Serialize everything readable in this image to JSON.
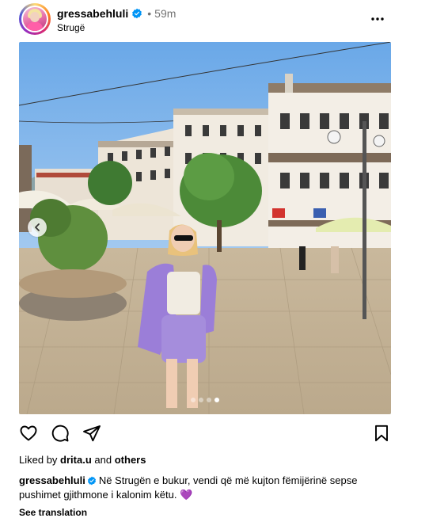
{
  "post": {
    "username": "gressabehluli",
    "verified": true,
    "separator": "•",
    "time": "59m",
    "location": "Strugë"
  },
  "icons": {
    "more": "more-dots-icon",
    "verified": "verified-badge-icon",
    "prev": "chevron-left-icon",
    "like": "heart-icon",
    "comment": "comment-bubble-icon",
    "share": "paper-plane-icon",
    "save": "bookmark-icon"
  },
  "carousel": {
    "dot_count": 4,
    "active_dot": 3
  },
  "likes": {
    "prefix": "Liked by",
    "user": "drita.u",
    "joiner": "and",
    "others": "others"
  },
  "caption": {
    "username": "gressabehluli",
    "text": "Në Strugën e bukur, vendi që më kujton fëmijërinë sepse pushimet gjithmone i kalonim këtu.",
    "emoji": "💜"
  },
  "see_translation": "See translation",
  "colors": {
    "verified_blue": "#0095f6",
    "muted_text": "#737373",
    "sky": "#b8d6f4"
  }
}
